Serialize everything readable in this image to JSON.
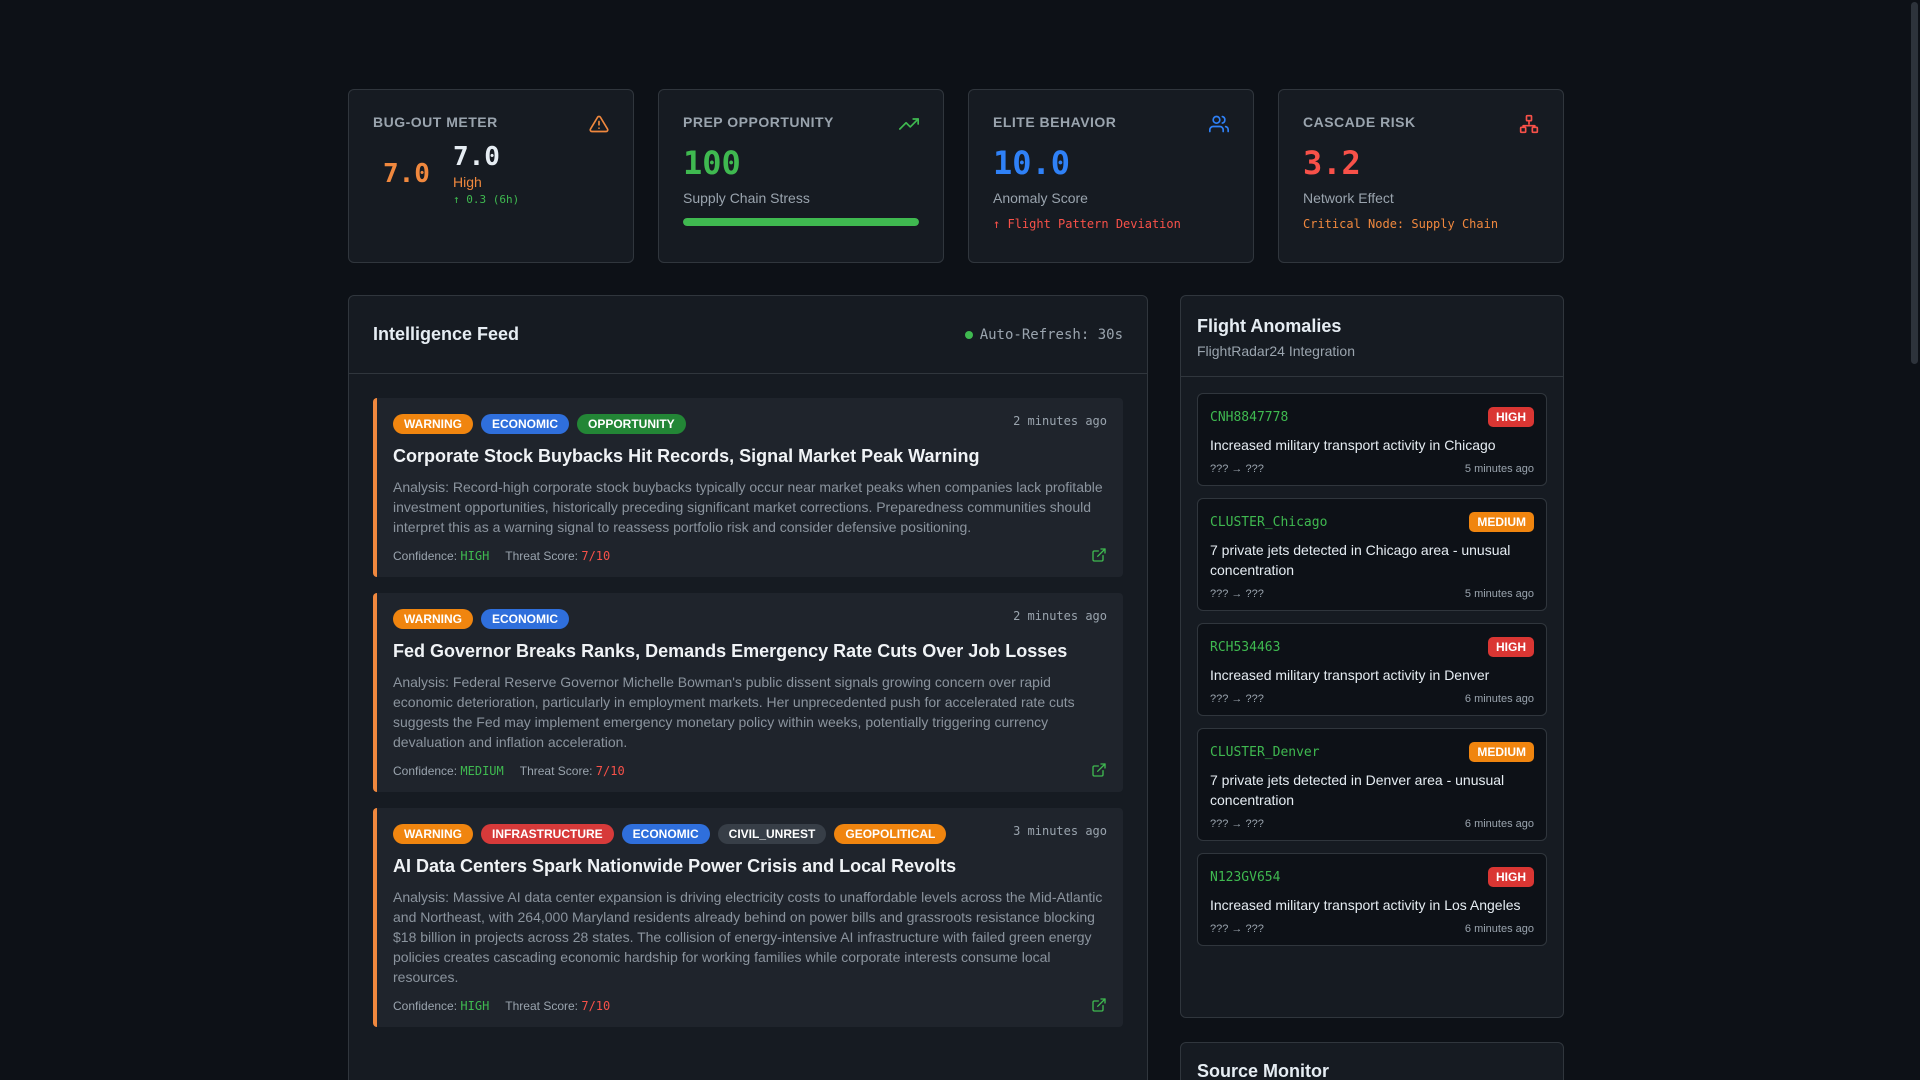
{
  "metrics": {
    "bugout": {
      "title": "BUG-OUT METER",
      "gauge_value": "7.0",
      "value": "7.0",
      "level": "High",
      "delta": "↑ 0.3 (6h)",
      "icon": "warning-triangle-icon"
    },
    "prep": {
      "title": "PREP OPPORTUNITY",
      "value": "100",
      "label": "Supply Chain Stress",
      "progress_percent": 100,
      "icon": "trending-up-icon"
    },
    "elite": {
      "title": "ELITE BEHAVIOR",
      "value": "10.0",
      "label": "Anomaly Score",
      "note": "↑ Flight Pattern Deviation",
      "icon": "users-icon"
    },
    "cascade": {
      "title": "CASCADE RISK",
      "value": "3.2",
      "label": "Network Effect",
      "note": "Critical Node: Supply Chain",
      "icon": "network-icon"
    }
  },
  "feed": {
    "title": "Intelligence Feed",
    "auto_refresh": "Auto-Refresh: 30s",
    "confidence_label": "Confidence:",
    "threat_label": "Threat Score:",
    "items": [
      {
        "tags": [
          "WARNING",
          "ECONOMIC",
          "OPPORTUNITY"
        ],
        "time": "2 minutes ago",
        "title": "Corporate Stock Buybacks Hit Records, Signal Market Peak Warning",
        "body": "Analysis: Record-high corporate stock buybacks typically occur near market peaks when companies lack profitable investment opportunities, historically preceding significant market corrections. Preparedness communities should interpret this as a warning signal to reassess portfolio risk and consider defensive positioning.",
        "confidence": "HIGH",
        "threat": "7/10"
      },
      {
        "tags": [
          "WARNING",
          "ECONOMIC"
        ],
        "time": "2 minutes ago",
        "title": "Fed Governor Breaks Ranks, Demands Emergency Rate Cuts Over Job Losses",
        "body": "Analysis: Federal Reserve Governor Michelle Bowman's public dissent signals growing concern over rapid economic deterioration, particularly in employment markets. Her unprecedented push for accelerated rate cuts suggests the Fed may implement emergency monetary policy within weeks, potentially triggering currency devaluation and inflation acceleration.",
        "confidence": "MEDIUM",
        "threat": "7/10"
      },
      {
        "tags": [
          "WARNING",
          "INFRASTRUCTURE",
          "ECONOMIC",
          "CIVIL_UNREST",
          "GEOPOLITICAL"
        ],
        "time": "3 minutes ago",
        "title": "AI Data Centers Spark Nationwide Power Crisis and Local Revolts",
        "body": "Analysis: Massive AI data center expansion is driving electricity costs to unaffordable levels across the Mid-Atlantic and Northeast, with 264,000 Maryland residents already behind on power bills and grassroots resistance blocking $18 billion in projects across 28 states. The collision of energy-intensive AI infrastructure with failed green energy policies creates cascading economic hardship for working families while corporate interests consume local resources.",
        "confidence": "HIGH",
        "threat": "7/10"
      }
    ]
  },
  "tag_colors": {
    "WARNING": "#f0850f",
    "ECONOMIC": "#2f6fdc",
    "OPPORTUNITY": "#238636",
    "INFRASTRUCTURE": "#d73a3a",
    "CIVIL_UNREST": "#373e47",
    "GEOPOLITICAL": "#f0850f"
  },
  "flights": {
    "title": "Flight Anomalies",
    "subtitle": "FlightRadar24 Integration",
    "items": [
      {
        "callsign": "CNH8847778",
        "severity": "HIGH",
        "desc": "Increased military transport activity in Chicago",
        "route": "??? → ???",
        "time": "5 minutes ago"
      },
      {
        "callsign": "CLUSTER_Chicago",
        "severity": "MEDIUM",
        "desc": "7 private jets detected in Chicago area - unusual concentration",
        "route": "??? → ???",
        "time": "5 minutes ago"
      },
      {
        "callsign": "RCH534463",
        "severity": "HIGH",
        "desc": "Increased military transport activity in Denver",
        "route": "??? → ???",
        "time": "6 minutes ago"
      },
      {
        "callsign": "CLUSTER_Denver",
        "severity": "MEDIUM",
        "desc": "7 private jets detected in Denver area - unusual concentration",
        "route": "??? → ???",
        "time": "6 minutes ago"
      },
      {
        "callsign": "N123GV654",
        "severity": "HIGH",
        "desc": "Increased military transport activity in Los Angeles",
        "route": "??? → ???",
        "time": "6 minutes ago"
      }
    ]
  },
  "severity_colors": {
    "HIGH": "#da3633",
    "MEDIUM": "#f0850f"
  },
  "source_monitor": {
    "title": "Source Monitor"
  },
  "colors": {
    "bugout": "#f0883e",
    "prep": "#3fb950",
    "elite": "#2f81f7",
    "cascade": "#f85149",
    "cascade_note": "#f0883e"
  }
}
